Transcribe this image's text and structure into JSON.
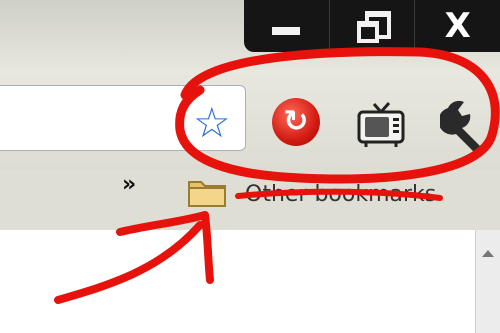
{
  "window": {
    "controls": [
      {
        "name": "minimize",
        "icon": "minimize-icon"
      },
      {
        "name": "maximize",
        "icon": "restore-icon"
      },
      {
        "name": "close",
        "icon": "close-icon"
      }
    ]
  },
  "toolbar": {
    "icons": [
      "star-icon",
      "reload-icon",
      "tv-icon",
      "wrench-icon"
    ]
  },
  "bookmarks_bar": {
    "chevron": "»",
    "folder_label": "Other bookmarks"
  },
  "annotation_color": "#e8120c"
}
